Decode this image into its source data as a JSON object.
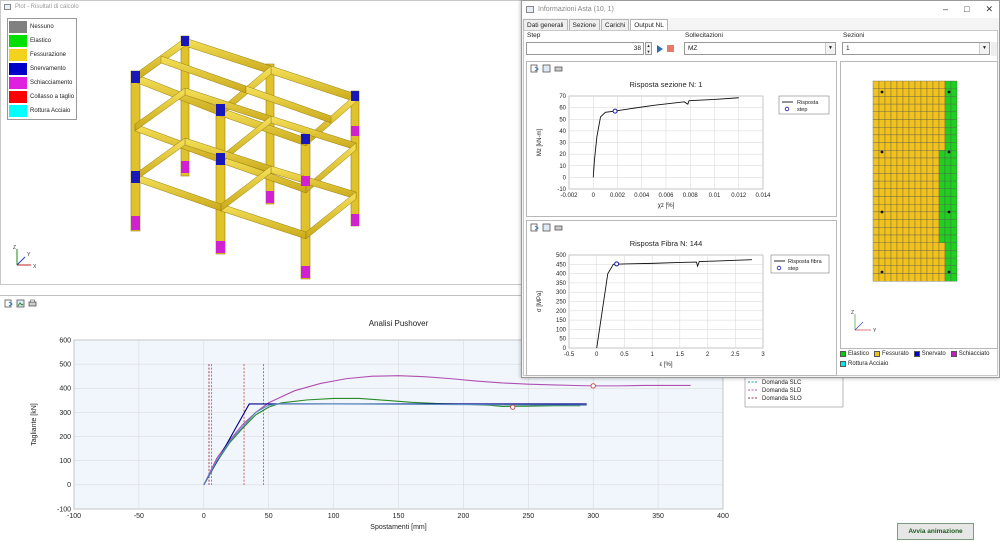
{
  "plot_window": {
    "title": "Plot - Risultati di calcolo",
    "legend": [
      {
        "label": "Nessuno",
        "color": "#808080"
      },
      {
        "label": "Elastico",
        "color": "#00e000"
      },
      {
        "label": "Fessurazione",
        "color": "#f2d21c"
      },
      {
        "label": "Snervamento",
        "color": "#0000c8"
      },
      {
        "label": "Schiacciamento",
        "color": "#e020e0"
      },
      {
        "label": "Collasso a taglio",
        "color": "#ff0000"
      },
      {
        "label": "Rottura Acciaio",
        "color": "#00ffff"
      }
    ],
    "axes_labels": {
      "z": "Z",
      "y": "Y",
      "x": "X"
    }
  },
  "pushover": {
    "toolbar": [
      "export-icon",
      "image-icon",
      "print-icon"
    ],
    "chart_data": {
      "type": "line",
      "title": "Analisi Pushover",
      "xlabel": "Spostamenti [mm]",
      "ylabel": "Tagliante [kN]",
      "xlim": [
        -100,
        400
      ],
      "ylim": [
        -100,
        600
      ],
      "xticks": [
        -100,
        -50,
        0,
        50,
        100,
        150,
        200,
        250,
        300,
        350,
        400
      ],
      "yticks": [
        -100,
        0,
        100,
        200,
        300,
        400,
        500,
        600
      ],
      "grid": true,
      "series": [
        {
          "name": "",
          "color": "#b050b0",
          "points": [
            [
              0,
              0
            ],
            [
              10,
              110
            ],
            [
              20,
              185
            ],
            [
              30,
              250
            ],
            [
              40,
              300
            ],
            [
              50,
              340
            ],
            [
              70,
              390
            ],
            [
              90,
              420
            ],
            [
              110,
              440
            ],
            [
              130,
              450
            ],
            [
              150,
              452
            ],
            [
              170,
              448
            ],
            [
              190,
              440
            ],
            [
              210,
              430
            ],
            [
              230,
              422
            ],
            [
              250,
              417
            ],
            [
              270,
              414
            ],
            [
              290,
              411
            ],
            [
              300,
              410
            ],
            [
              320,
              410
            ],
            [
              340,
              412
            ],
            [
              360,
              412
            ],
            [
              375,
              412
            ]
          ]
        },
        {
          "name": "",
          "color": "#2a8a2a",
          "points": [
            [
              0,
              0
            ],
            [
              10,
              95
            ],
            [
              20,
              175
            ],
            [
              30,
              235
            ],
            [
              40,
              290
            ],
            [
              50,
              322
            ],
            [
              60,
              340
            ],
            [
              80,
              352
            ],
            [
              100,
              358
            ],
            [
              120,
              358
            ],
            [
              140,
              350
            ],
            [
              160,
              342
            ],
            [
              180,
              337
            ],
            [
              200,
              334
            ],
            [
              220,
              330
            ],
            [
              230,
              325
            ],
            [
              250,
              326
            ],
            [
              270,
              328
            ],
            [
              290,
              328
            ]
          ]
        },
        {
          "name": "",
          "color": "#00008b",
          "points": [
            [
              0,
              0
            ],
            [
              35,
              335
            ],
            [
              295,
              335
            ]
          ]
        },
        {
          "name": "",
          "color": "#5a8abf",
          "points": [
            [
              0,
              0
            ],
            [
              10,
              100
            ],
            [
              20,
              180
            ],
            [
              30,
              240
            ],
            [
              40,
              300
            ],
            [
              50,
              330
            ],
            [
              60,
              336
            ],
            [
              295,
              330
            ]
          ]
        }
      ],
      "markers": [
        {
          "x": 238,
          "y": 322,
          "color": "#c04040"
        },
        {
          "x": 300,
          "y": 410,
          "color": "#c04040"
        }
      ],
      "demand_lines": [
        {
          "name": "Domanda SLV",
          "x": 31,
          "color": "#c85050"
        },
        {
          "name": "Domanda SLC",
          "x": 46,
          "color": "#20a0a0"
        },
        {
          "name": "Domanda SLD",
          "x": 6,
          "color": "#c050c0"
        },
        {
          "name": "Domanda SLO",
          "x": 4,
          "color": "#a03040"
        }
      ]
    }
  },
  "info_window": {
    "title": "Informazioni Asta (10, 1)",
    "tabs": [
      "Dati generali",
      "Sezione",
      "Carichi",
      "Output NL"
    ],
    "active_tab": "Output NL",
    "step_label": "Step",
    "step_value": "38",
    "sollecitazioni_label": "Sollecitazioni",
    "sollecitazioni_value": "MZ",
    "sezioni_label": "Sezioni",
    "sezioni_value": "1",
    "section_response": {
      "chart_data": {
        "type": "line",
        "title": "Risposta sezione N: 1",
        "xlabel": "χz [%]",
        "ylabel": "Mz [kN-m]",
        "xlim": [
          -0.002,
          0.014
        ],
        "ylim": [
          -10,
          70
        ],
        "xticks": [
          "-0.002",
          "0",
          "0.002",
          "0.004",
          "0.006",
          "0.008",
          "0.01",
          "0.012",
          "0.014"
        ],
        "yticks": [
          -10,
          0,
          10,
          20,
          30,
          40,
          50,
          60,
          70
        ],
        "legend": [
          "Risposta",
          "step"
        ],
        "series": [
          {
            "name": "Risposta",
            "points": [
              [
                0,
                0
              ],
              [
                0.0001,
                15
              ],
              [
                0.0003,
                35
              ],
              [
                0.0006,
                52
              ],
              [
                0.001,
                56
              ],
              [
                0.0018,
                57
              ],
              [
                0.003,
                59
              ],
              [
                0.005,
                62
              ],
              [
                0.0075,
                65
              ],
              [
                0.0078,
                63
              ],
              [
                0.0079,
                66
              ],
              [
                0.01,
                67
              ],
              [
                0.012,
                68.5
              ]
            ]
          }
        ],
        "step_marker": {
          "x": 0.0018,
          "y": 57
        }
      }
    },
    "fiber_response": {
      "chart_data": {
        "type": "line",
        "title": "Risposta Fibra N: 144",
        "xlabel": "ε [%]",
        "ylabel": "σ [MPa]",
        "xlim": [
          -0.5,
          3
        ],
        "ylim": [
          0,
          500
        ],
        "xticks": [
          "-0.5",
          "0",
          "0.5",
          "1",
          "1.5",
          "2",
          "2.5",
          "3"
        ],
        "yticks": [
          0,
          50,
          100,
          150,
          200,
          250,
          300,
          350,
          400,
          450,
          500
        ],
        "legend": [
          "Risposta fibra",
          "step"
        ],
        "series": [
          {
            "name": "Risposta fibra",
            "points": [
              [
                0,
                0
              ],
              [
                0.2,
                400
              ],
              [
                0.3,
                450
              ],
              [
                0.5,
                452
              ],
              [
                1.0,
                455
              ],
              [
                1.5,
                460
              ],
              [
                1.8,
                462
              ],
              [
                1.82,
                440
              ],
              [
                1.85,
                465
              ],
              [
                2.2,
                468
              ],
              [
                2.8,
                475
              ]
            ]
          }
        ],
        "step_marker": {
          "x": 0.36,
          "y": 452
        }
      }
    },
    "section_legend": [
      {
        "label": "Elastico",
        "color": "#00d000"
      },
      {
        "label": "Fessurato",
        "color": "#f2c21c"
      },
      {
        "label": "Snervato",
        "color": "#0000c8"
      },
      {
        "label": "Schiacciato",
        "color": "#c020c0"
      },
      {
        "label": "Rottura Acciaio",
        "color": "#00e8e8"
      }
    ]
  },
  "anim_button": "Avvia animazione"
}
